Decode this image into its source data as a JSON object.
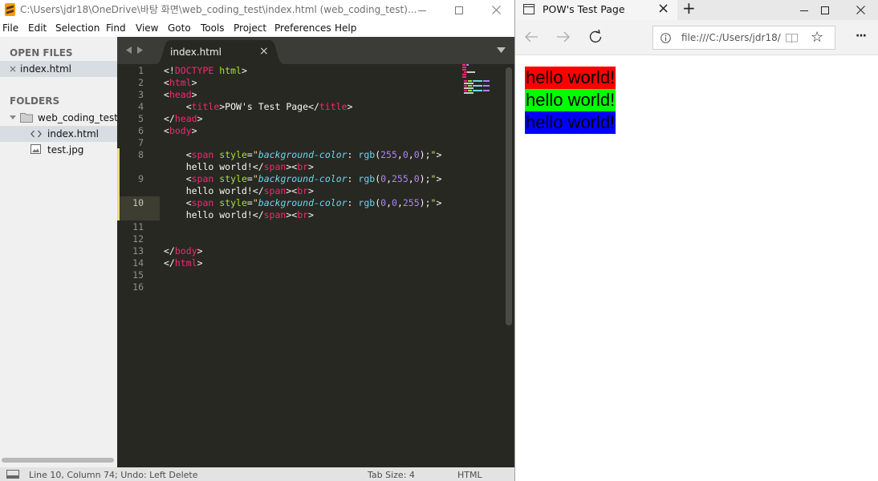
{
  "sublime": {
    "title": "C:\\Users\\jdr18\\OneDrive\\바탕 화면\\web_coding_test\\index.html (web_coding_test)...",
    "menu": [
      "File",
      "Edit",
      "Selection",
      "Find",
      "View",
      "Goto",
      "Tools",
      "Project",
      "Preferences",
      "Help"
    ],
    "sidebar": {
      "open_files_header": "OPEN FILES",
      "open_file_close": "×",
      "open_file": "index.html",
      "folders_header": "FOLDERS",
      "folder_name": "web_coding_test",
      "files": [
        "index.html",
        "test.jpg"
      ]
    },
    "tab": {
      "label": "index.html",
      "close": "×"
    },
    "line_numbers": [
      "1",
      "2",
      "3",
      "4",
      "5",
      "6",
      "7",
      "8",
      "9",
      "10",
      "11",
      "12",
      "13",
      "14",
      "15",
      "16"
    ],
    "current_line": "10",
    "code": {
      "l1": [
        "<!",
        "DOCTYPE",
        " ",
        "html",
        ">"
      ],
      "l2": [
        "<",
        "html",
        ">"
      ],
      "l3": [
        "<",
        "head",
        ">"
      ],
      "l4": [
        "    <",
        "title",
        ">POW's Test Page</",
        "title",
        ">"
      ],
      "l5": [
        "</",
        "head",
        ">"
      ],
      "l6": [
        "<",
        "body",
        ">"
      ],
      "l8a": [
        "    <",
        "span",
        " ",
        "style",
        "=",
        "\"",
        "background-color",
        ": ",
        "rgb",
        "(",
        "255",
        ",",
        "0",
        ",",
        "0",
        ");",
        "\"",
        ">"
      ],
      "l8b": [
        "    hello world!</",
        "span",
        "><",
        "br",
        ">"
      ],
      "l9a": [
        "    <",
        "span",
        " ",
        "style",
        "=",
        "\"",
        "background-color",
        ": ",
        "rgb",
        "(",
        "0",
        ",",
        "255",
        ",",
        "0",
        ");",
        "\"",
        ">"
      ],
      "l9b": [
        "    hello world!</",
        "span",
        "><",
        "br",
        ">"
      ],
      "l10a": [
        "    <",
        "span",
        " ",
        "style",
        "=",
        "\"",
        "background-color",
        ": ",
        "rgb",
        "(",
        "0",
        ",",
        "0",
        ",",
        "255",
        ");",
        "\"",
        ">"
      ],
      "l10b": [
        "    hello world!</",
        "span",
        "><",
        "br",
        ">"
      ],
      "l13": [
        "</",
        "body",
        ">"
      ],
      "l14": [
        "</",
        "html",
        ">"
      ]
    },
    "status": {
      "position": "Line 10, Column 74; Undo: Left Delete",
      "tab_size": "Tab Size: 4",
      "syntax": "HTML"
    }
  },
  "edge": {
    "tab_title": "POW's Test Page",
    "tab_close": "×",
    "new_tab": "+",
    "url": "file:///C:/Users/jdr18/",
    "favorite_glyph": "☆",
    "more_glyph": "···",
    "page_lines": [
      {
        "text": "hello world!",
        "bg": "#ff0000"
      },
      {
        "text": "hello world!",
        "bg": "#00ff00"
      },
      {
        "text": "hello world!",
        "bg": "#0000ff"
      }
    ]
  }
}
